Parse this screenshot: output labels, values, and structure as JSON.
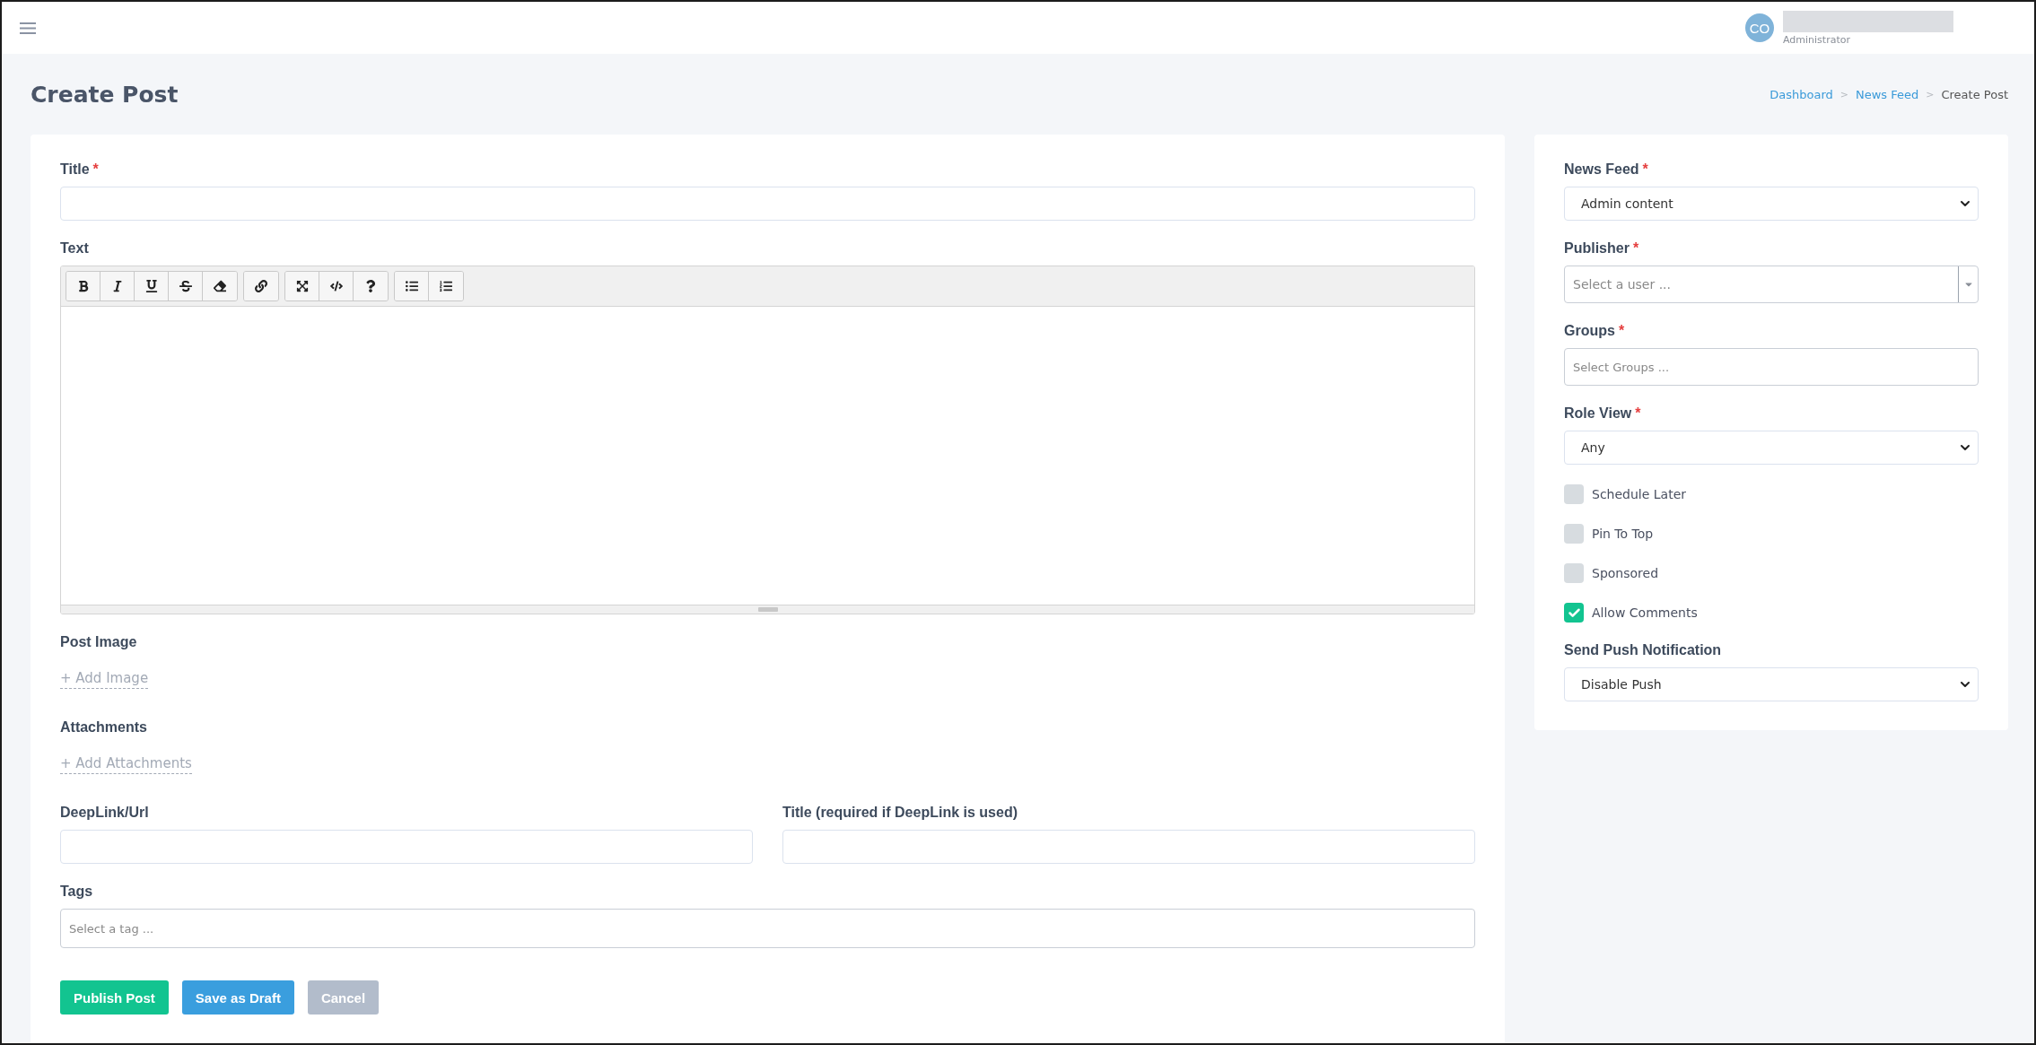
{
  "topbar": {
    "avatar_initials": "CO",
    "user_role": "Administrator"
  },
  "header": {
    "title": "Create Post",
    "breadcrumb": [
      {
        "kind": "link",
        "label": "Dashboard"
      },
      {
        "kind": "separator",
        "label": ">"
      },
      {
        "kind": "link",
        "label": "News Feed"
      },
      {
        "kind": "separator",
        "label": ">"
      },
      {
        "kind": "current",
        "label": "Create Post"
      }
    ]
  },
  "main_form": {
    "title_field": {
      "label": "Title",
      "required_mark": "*"
    },
    "text_editor": {
      "label": "Text"
    },
    "post_image": {
      "label": "Post Image",
      "action": "+ Add Image"
    },
    "attachments": {
      "label": "Attachments",
      "action": "+ Add Attachments"
    },
    "deeplink": {
      "label": "DeepLink/Url"
    },
    "deeplink_title": {
      "label": "Title (required if DeepLink is used)"
    },
    "tags": {
      "label": "Tags",
      "placeholder": "Select a tag ..."
    },
    "buttons": [
      {
        "kind": "success",
        "label": "Publish Post"
      },
      {
        "kind": "info",
        "label": "Save as Draft"
      },
      {
        "kind": "muted",
        "label": "Cancel"
      }
    ]
  },
  "side_form": {
    "news_feed": {
      "label": "News Feed",
      "required_mark": "*",
      "value": "Admin content"
    },
    "publisher": {
      "label": "Publisher",
      "required_mark": "*",
      "placeholder": "Select a user ..."
    },
    "groups": {
      "label": "Groups",
      "required_mark": "*",
      "placeholder": "Select Groups ..."
    },
    "role_view": {
      "label": "Role View",
      "required_mark": "*",
      "value": "Any"
    },
    "options": [
      {
        "label": "Schedule Later",
        "checked": false
      },
      {
        "label": "Pin To Top",
        "checked": false
      },
      {
        "label": "Sponsored",
        "checked": false
      },
      {
        "label": "Allow Comments",
        "checked": true
      }
    ],
    "push": {
      "label": "Send Push Notification",
      "value": "Disable Push"
    }
  }
}
